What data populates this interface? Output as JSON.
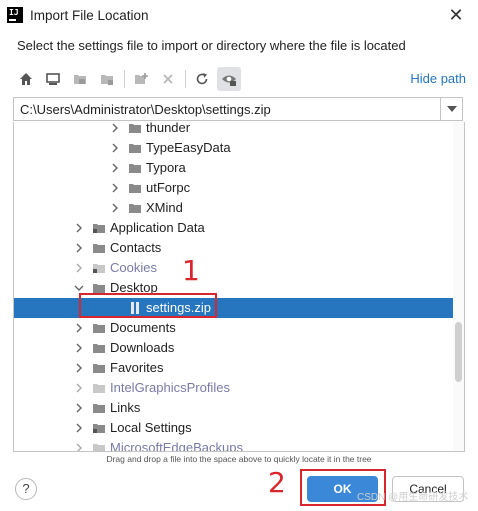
{
  "window": {
    "title": "Import File Location",
    "close_glyph": "✕"
  },
  "instruction": "Select the settings file to import or directory where the file is located",
  "toolbar": {
    "icons": [
      "home-icon",
      "desktop-icon",
      "project-folder-icon",
      "module-folder-icon",
      "new-folder-icon",
      "delete-icon",
      "refresh-icon",
      "show-hidden-icon"
    ],
    "hide_path_label": "Hide path"
  },
  "path": {
    "value": "C:\\Users\\Administrator\\Desktop\\settings.zip"
  },
  "tree": {
    "rows": [
      {
        "label": "thunder",
        "muted": false,
        "selected": false,
        "level": 2,
        "expanded": false,
        "kind": "folder"
      },
      {
        "label": "TypeEasyData",
        "muted": false,
        "selected": false,
        "level": 2,
        "expanded": false,
        "kind": "folder"
      },
      {
        "label": "Typora",
        "muted": false,
        "selected": false,
        "level": 2,
        "expanded": false,
        "kind": "folder"
      },
      {
        "label": "utForpc",
        "muted": false,
        "selected": false,
        "level": 2,
        "expanded": false,
        "kind": "folder"
      },
      {
        "label": "XMind",
        "muted": false,
        "selected": false,
        "level": 2,
        "expanded": false,
        "kind": "folder"
      },
      {
        "label": "Application Data",
        "muted": false,
        "selected": false,
        "level": 1,
        "expanded": false,
        "kind": "link-folder"
      },
      {
        "label": "Contacts",
        "muted": false,
        "selected": false,
        "level": 1,
        "expanded": false,
        "kind": "folder"
      },
      {
        "label": "Cookies",
        "muted": true,
        "selected": false,
        "level": 1,
        "expanded": false,
        "kind": "link-folder"
      },
      {
        "label": "Desktop",
        "muted": false,
        "selected": false,
        "level": 1,
        "expanded": true,
        "kind": "folder"
      },
      {
        "label": "settings.zip",
        "muted": false,
        "selected": true,
        "level": 2,
        "expanded": null,
        "kind": "zip"
      },
      {
        "label": "Documents",
        "muted": false,
        "selected": false,
        "level": 1,
        "expanded": false,
        "kind": "folder"
      },
      {
        "label": "Downloads",
        "muted": false,
        "selected": false,
        "level": 1,
        "expanded": false,
        "kind": "folder"
      },
      {
        "label": "Favorites",
        "muted": false,
        "selected": false,
        "level": 1,
        "expanded": false,
        "kind": "folder"
      },
      {
        "label": "IntelGraphicsProfiles",
        "muted": true,
        "selected": false,
        "level": 1,
        "expanded": false,
        "kind": "folder"
      },
      {
        "label": "Links",
        "muted": false,
        "selected": false,
        "level": 1,
        "expanded": false,
        "kind": "folder"
      },
      {
        "label": "Local Settings",
        "muted": false,
        "selected": false,
        "level": 1,
        "expanded": false,
        "kind": "link-folder"
      },
      {
        "label": "MicrosoftEdgeBackups",
        "muted": true,
        "selected": false,
        "level": 1,
        "expanded": false,
        "kind": "folder"
      }
    ]
  },
  "hint": "Drag and drop a file into the space above to quickly locate it in the tree",
  "buttons": {
    "help": "?",
    "ok": "OK",
    "cancel": "Cancel"
  },
  "annotations": {
    "marker_1": "1",
    "marker_2": "2"
  },
  "watermark": "CSDN @用生命研发技术",
  "colors": {
    "selection": "#2675bf",
    "link": "#2675bf",
    "annotation": "#d9262c",
    "ok_button": "#3b88d8"
  }
}
